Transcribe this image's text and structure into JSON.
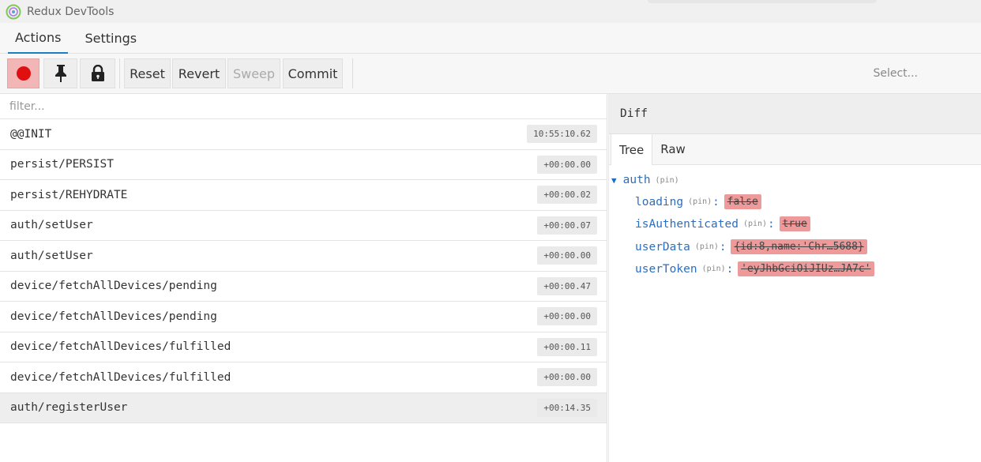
{
  "window": {
    "title": "Redux DevTools",
    "logo_icon": "redux-devtools-logo",
    "accent": "#1f7ec2"
  },
  "main_tabs": [
    {
      "label": "Actions",
      "active": true
    },
    {
      "label": "Settings",
      "active": false
    }
  ],
  "toolbar": {
    "record_icon": "record-icon",
    "pin_icon": "pin-icon",
    "lock_icon": "lock-icon",
    "reset_label": "Reset",
    "revert_label": "Revert",
    "sweep_label": "Sweep",
    "commit_label": "Commit",
    "instance_select_placeholder": "Select..."
  },
  "actions_panel": {
    "filter_placeholder": "filter...",
    "actions": [
      {
        "name": "@@INIT",
        "time": "10:55:10.62",
        "selected": false
      },
      {
        "name": "persist/PERSIST",
        "time": "+00:00.00",
        "selected": false
      },
      {
        "name": "persist/REHYDRATE",
        "time": "+00:00.02",
        "selected": false
      },
      {
        "name": "auth/setUser",
        "time": "+00:00.07",
        "selected": false
      },
      {
        "name": "auth/setUser",
        "time": "+00:00.00",
        "selected": false
      },
      {
        "name": "device/fetchAllDevices/pending",
        "time": "+00:00.47",
        "selected": false
      },
      {
        "name": "device/fetchAllDevices/pending",
        "time": "+00:00.00",
        "selected": false
      },
      {
        "name": "device/fetchAllDevices/fulfilled",
        "time": "+00:00.11",
        "selected": false
      },
      {
        "name": "device/fetchAllDevices/fulfilled",
        "time": "+00:00.00",
        "selected": false
      },
      {
        "name": "auth/registerUser",
        "time": "+00:14.35",
        "selected": true
      }
    ]
  },
  "diff_panel": {
    "header": "Diff",
    "tabs": [
      {
        "label": "Tree",
        "active": true
      },
      {
        "label": "Raw",
        "active": false
      }
    ],
    "tree": {
      "root_key": "auth",
      "root_pin": "(pin)",
      "expanded_arrow": "▼",
      "colon": ":",
      "entries": [
        {
          "key": "loading",
          "pin": "(pin)",
          "removed_value": "false"
        },
        {
          "key": "isAuthenticated",
          "pin": "(pin)",
          "removed_value": "true"
        },
        {
          "key": "userData",
          "pin": "(pin)",
          "removed_value": "{id:8,name:'Chr…5688}"
        },
        {
          "key": "userToken",
          "pin": "(pin)",
          "removed_value": "'eyJhbGciOiJIUz…JA7c'"
        }
      ]
    },
    "removed_color": "#ef9a9a"
  }
}
